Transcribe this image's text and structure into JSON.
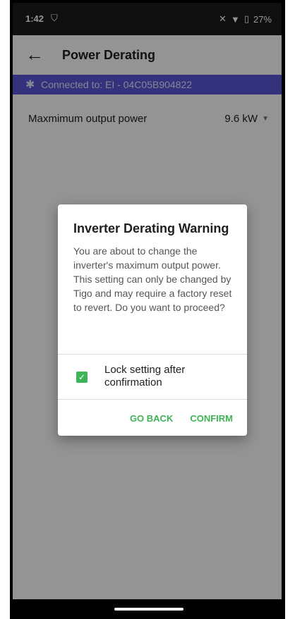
{
  "status_bar": {
    "time": "1:42",
    "battery": "27%"
  },
  "app_bar": {
    "title": "Power Derating"
  },
  "connection": {
    "text": "Connected to: EI - 04C05B904822"
  },
  "setting": {
    "label": "Maxmimum output power",
    "value": "9.6 kW"
  },
  "dialog": {
    "title": "Inverter Derating Warning",
    "body": "You are about to change the inverter's maximum output power. This setting can only be changed by Tigo and may require a factory reset to revert. Do you want to proceed?",
    "checkbox_label": "Lock setting after confirmation",
    "checkbox_checked": true,
    "go_back_label": "GO BACK",
    "confirm_label": "CONFIRM"
  },
  "colors": {
    "accent": "#3db557",
    "connection_bar": "#5a57d6"
  },
  "icons": {
    "back": "arrow-left-icon",
    "bluetooth": "bluetooth-icon",
    "dropdown": "chevron-down-icon",
    "status_extra": "vpn-icon",
    "wifi": "wifi-icon",
    "battery": "battery-icon",
    "mute": "mute-icon"
  }
}
